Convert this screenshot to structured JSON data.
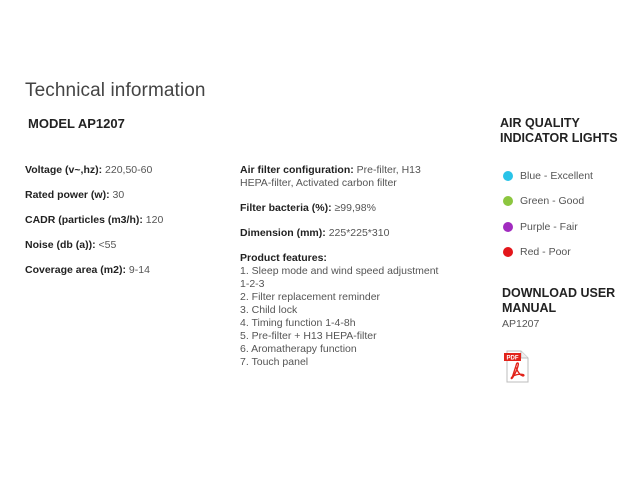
{
  "page": {
    "title": "Technical information",
    "model": "MODEL AP1207"
  },
  "specs_left": [
    {
      "key": "Voltage (v~,hz):",
      "value": "220,50-60"
    },
    {
      "key": "Rated power (w):",
      "value": "30"
    },
    {
      "key": "CADR (particles (m3/h):",
      "value": "120"
    },
    {
      "key": "Noise (db (a)):",
      "value": "<55"
    },
    {
      "key": "Coverage area (m2):",
      "value": "9-14"
    }
  ],
  "specs_mid": [
    {
      "key": "Air filter configuration:",
      "value": "Pre-filter, H13 HEPA-filter, Activated carbon filter"
    },
    {
      "key": "Filter bacteria (%):",
      "value": "≥99,98%"
    },
    {
      "key": "Dimension (mm):",
      "value": "225*225*310"
    }
  ],
  "features": {
    "title": "Product features:",
    "items": [
      "1. Sleep mode and wind speed adjustment 1-2-3",
      "2. Filter replacement reminder",
      "3. Child lock",
      "4. Timing function 1-4-8h",
      "5. Pre-filter + H13 HEPA-filter",
      "6. Aromatherapy function",
      "7. Touch panel"
    ]
  },
  "air_quality": {
    "title": "AIR QUALITY INDICATOR LIGHTS",
    "items": [
      {
        "label": "Blue - Excellent",
        "color": "#29c3e8"
      },
      {
        "label": "Green - Good",
        "color": "#8cc63f"
      },
      {
        "label": "Purple - Fair",
        "color": "#a12bbf"
      },
      {
        "label": "Red - Poor",
        "color": "#e3161b"
      }
    ]
  },
  "download": {
    "title": "DOWNLOAD USER MANUAL",
    "model": "AP1207",
    "pdf_badge": "PDF",
    "pdf_icon": "pdf-file-icon",
    "pdf_color": "#e2231a"
  }
}
